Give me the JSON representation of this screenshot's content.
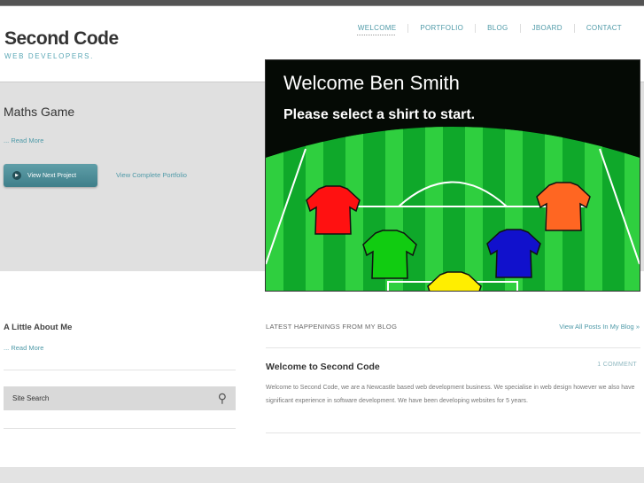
{
  "header": {
    "logo": "Second Code",
    "tagline": "WEB DEVELOPERS."
  },
  "nav": {
    "items": [
      "WELCOME",
      "PORTFOLIO",
      "BLOG",
      "JBOARD",
      "CONTACT"
    ],
    "active": "WELCOME"
  },
  "featured": {
    "title": "Maths Game",
    "read_more": "... Read More",
    "next_button": "View Next Project",
    "portfolio_link": "View Complete Portfolio"
  },
  "hero": {
    "heading": "Welcome Ben Smith",
    "subheading": "Please select a shirt to start."
  },
  "about": {
    "title": "A Little About Me",
    "read_more": "... Read More"
  },
  "search": {
    "label": "Site Search"
  },
  "blog": {
    "heading": "LATEST HAPPENINGS FROM MY BLOG",
    "view_all": "View All Posts In My Blog »",
    "post": {
      "title": "Welcome to Second Code",
      "comments": "1 COMMENT",
      "body": "Welcome to Second Code, we are a Newcastle based web development business. We specialise in web design however we also have significant experience in software development. We have been developing websites for 5 years."
    }
  },
  "colors": {
    "accent": "#4f9aa8",
    "band": "#e0e0e0",
    "topbar": "#545454"
  }
}
